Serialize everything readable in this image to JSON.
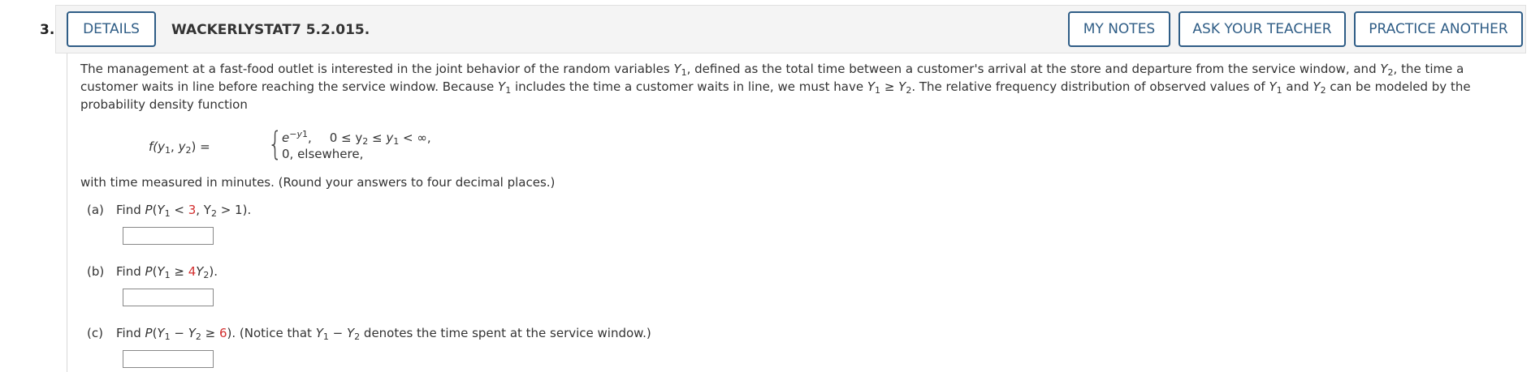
{
  "question": {
    "number": "3.",
    "details_label": "DETAILS",
    "code": "WACKERLYSTAT7 5.2.015."
  },
  "toolbar": {
    "my_notes_label": "MY NOTES",
    "ask_teacher_label": "ASK YOUR TEACHER",
    "practice_label": "PRACTICE ANOTHER"
  },
  "body": {
    "intro_1": "The management at a fast-food outlet is interested in the joint behavior of the random variables ",
    "intro_2": ", defined as the total time between a customer's arrival at the store and departure from the service window, and ",
    "intro_3": ", the time a customer waits in line before reaching the service window. Because ",
    "intro_4": " includes the time a customer waits in line, we must have ",
    "intro_5": ". The relative frequency distribution of observed values of ",
    "intro_6": " and ",
    "intro_7": " can be modeled by the probability density function",
    "density_lhs": "f(y",
    "density_case1_expr": "e",
    "density_case1_cond": "0 ≤ y",
    "density_case2": "0, elsewhere,",
    "after_text": "with time measured in minutes. (Round your answers to four decimal places.)"
  },
  "parts": [
    {
      "label": "(a)",
      "prefix": "Find ",
      "red_value": "3",
      "suffix": ", Y"
    },
    {
      "label": "(b)",
      "prefix": "Find ",
      "red_value": "4",
      "suffix": ")."
    },
    {
      "label": "(c)",
      "prefix": "Find ",
      "red_value": "6",
      "suffix": "). (Notice that ",
      "note": " denotes the time spent at the service window.)"
    }
  ],
  "colors": {
    "accent": "#2f5d86",
    "highlight": "#d32f2f",
    "header_bg": "#f4f4f4"
  }
}
